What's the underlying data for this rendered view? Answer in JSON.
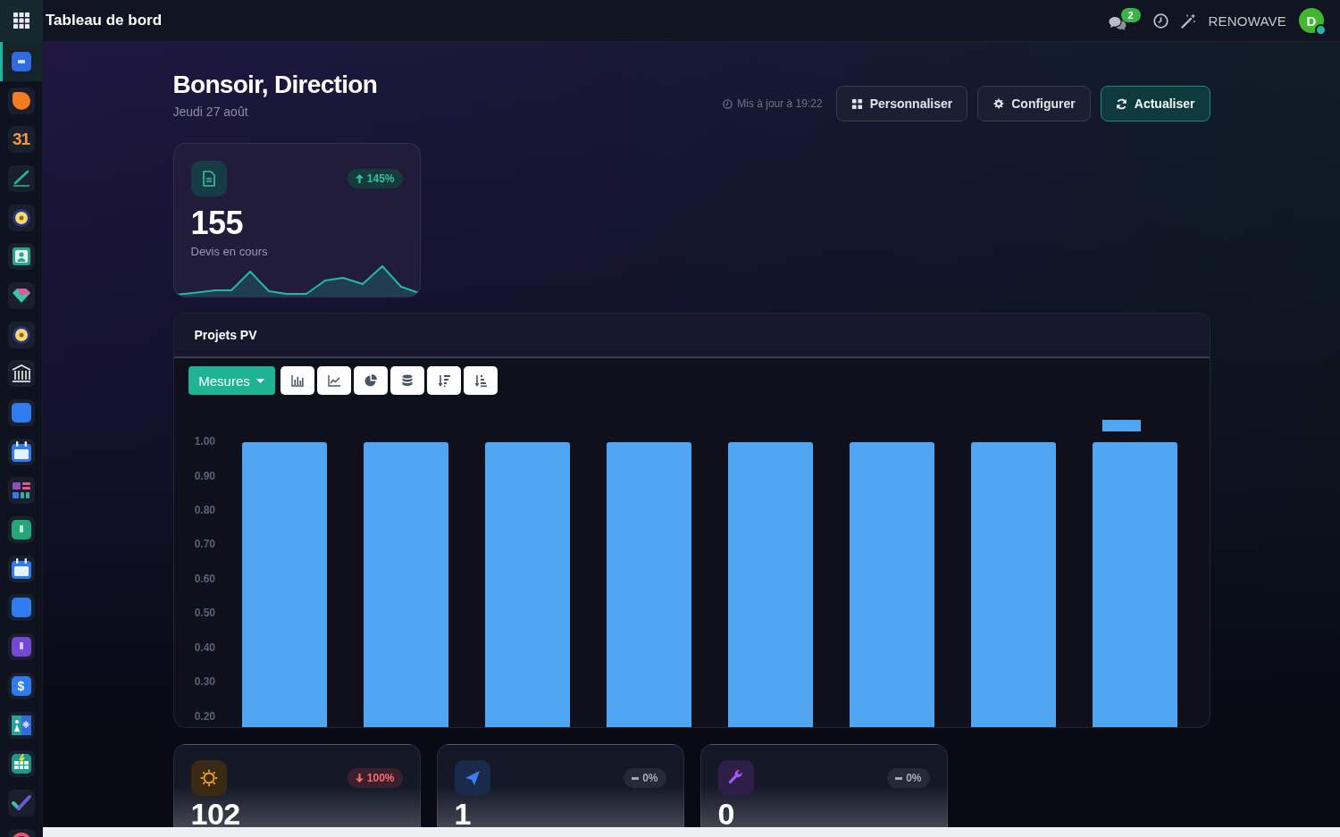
{
  "top_bar": {
    "title": "Tableau de bord",
    "messages_badge": "2",
    "company": "RENOWAVE",
    "avatar_initial": "D"
  },
  "sidebar": {
    "items": [
      {
        "selected": true
      },
      {
        "selected": false
      },
      {
        "selected": false,
        "label": "31"
      },
      {
        "selected": false
      },
      {
        "selected": false
      },
      {
        "selected": false
      },
      {
        "selected": false
      },
      {
        "selected": false
      },
      {
        "selected": false
      },
      {
        "selected": false
      },
      {
        "selected": false
      },
      {
        "selected": false
      },
      {
        "selected": false
      },
      {
        "selected": false
      },
      {
        "selected": false
      },
      {
        "selected": false
      },
      {
        "selected": false,
        "label": "$"
      },
      {
        "selected": false
      },
      {
        "selected": false
      },
      {
        "selected": false
      },
      {
        "selected": false
      }
    ]
  },
  "header": {
    "greeting": "Bonsoir, Direction",
    "date": "Jeudi 27 août",
    "updated": "Mis à jour à 19:22",
    "buttons": [
      {
        "label": "Personnaliser",
        "kind": "outline"
      },
      {
        "label": "Configurer",
        "kind": "outline"
      },
      {
        "label": "Actualiser",
        "kind": "accent"
      }
    ]
  },
  "kpi": {
    "value": "155",
    "label": "Devis en cours",
    "trend": "145%",
    "kind": "increase"
  },
  "chart_panel": {
    "title": "Projets PV",
    "measures_button": "Mesures",
    "chart_data": {
      "type": "bar",
      "series": [
        {
          "color": "#4ea5f1",
          "values": [
            1,
            1,
            1,
            1,
            1,
            1,
            1,
            1
          ]
        }
      ],
      "ylim": [
        0.17,
        1
      ],
      "yticks": [
        {
          "value": 1,
          "label": "1.00"
        },
        {
          "value": 0.9,
          "label": "0.90"
        },
        {
          "value": 0.8,
          "label": "0.80"
        },
        {
          "value": 0.7,
          "label": "0.70"
        },
        {
          "value": 0.6,
          "label": "0.60"
        },
        {
          "value": 0.5,
          "label": "0.50"
        },
        {
          "value": 0.4,
          "label": "0.40"
        },
        {
          "value": 0.3,
          "label": "0.30"
        },
        {
          "value": 0.2,
          "label": "0.20"
        }
      ]
    }
  },
  "summary_cards": [
    {
      "value": "102",
      "trend": "100%",
      "kind": "decrease"
    },
    {
      "value": "1",
      "trend": "0%",
      "kind": "neutral"
    },
    {
      "value": "0",
      "trend": "0%",
      "kind": "neutral"
    }
  ]
}
